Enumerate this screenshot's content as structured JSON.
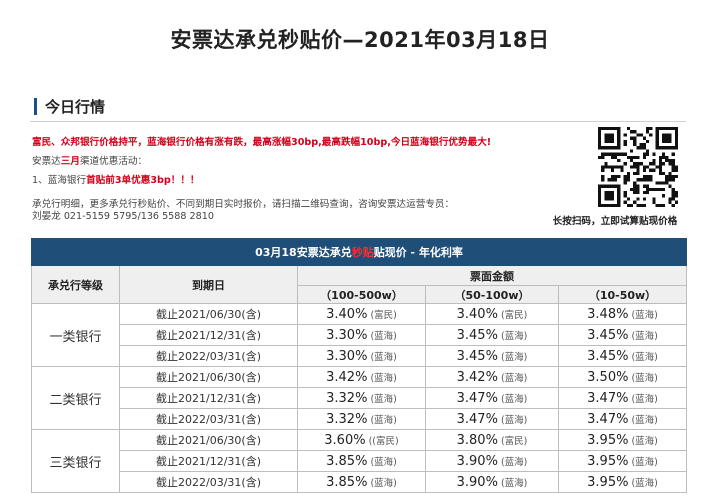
{
  "page_title": "安票达承兑秒贴价—2021年03月18日",
  "section_title": "今日行情",
  "notice": {
    "headline": "富民、众邦银行价格持平，蓝海银行价格有涨有跌，最高涨幅30bp,最高跌幅10bp,今日蓝海银行优势最大!",
    "promo_prefix": "安票达",
    "promo_highlight": "三月",
    "promo_suffix": "渠道优惠活动：",
    "promo_item_prefix": "1、蓝海银行",
    "promo_item_highlight": "首贴前3单优惠3bp！！！",
    "contact_line1": "承兑行明细，更多承兑行秒贴价、不同到期日实时报价，请扫描二维码查询，咨询安票达运营专员：",
    "contact_line2": "刘晏龙 021-5159 5795/136 5588 2810"
  },
  "qr": {
    "icon": "qr-code-icon",
    "caption": "长按扫码，立即试算贴现价格"
  },
  "table": {
    "title_prefix": "03月18安票达承兑",
    "title_highlight": "秒贴",
    "title_suffix": "贴现价 - 年化利率",
    "header_bank": "承兑行等级",
    "header_date": "到期日",
    "header_amount": "票面金额",
    "amount_cols": [
      "（100-500w）",
      "（50-100w）",
      "（10-50w）"
    ],
    "groups": [
      {
        "bank": "一类银行",
        "rows": [
          {
            "date": "截止2021/06/30(含)",
            "cells": [
              {
                "rate": "3.40%",
                "src": " (富民)"
              },
              {
                "rate": "3.40%",
                "src": " (富民)"
              },
              {
                "rate": "3.48%",
                "src": " (蓝海)"
              }
            ]
          },
          {
            "date": "截止2021/12/31(含)",
            "cells": [
              {
                "rate": "3.30%",
                "src": " (蓝海)"
              },
              {
                "rate": "3.45%",
                "src": " (蓝海)"
              },
              {
                "rate": "3.45%",
                "src": " (蓝海)"
              }
            ]
          },
          {
            "date": "截止2022/03/31(含)",
            "cells": [
              {
                "rate": "3.30%",
                "src": " (蓝海)"
              },
              {
                "rate": "3.45%",
                "src": " (蓝海)"
              },
              {
                "rate": "3.45%",
                "src": " (蓝海)"
              }
            ]
          }
        ]
      },
      {
        "bank": "二类银行",
        "rows": [
          {
            "date": "截止2021/06/30(含)",
            "cells": [
              {
                "rate": "3.42%",
                "src": " (蓝海)"
              },
              {
                "rate": "3.42%",
                "src": " (蓝海)"
              },
              {
                "rate": "3.50%",
                "src": " (蓝海)"
              }
            ]
          },
          {
            "date": "截止2021/12/31(含)",
            "cells": [
              {
                "rate": "3.32%",
                "src": " (蓝海)"
              },
              {
                "rate": "3.47%",
                "src": " (蓝海)"
              },
              {
                "rate": "3.47%",
                "src": " (蓝海)"
              }
            ]
          },
          {
            "date": "截止2022/03/31(含)",
            "cells": [
              {
                "rate": "3.32%",
                "src": " (蓝海)"
              },
              {
                "rate": "3.47%",
                "src": " (蓝海)"
              },
              {
                "rate": "3.47%",
                "src": " (蓝海)"
              }
            ]
          }
        ]
      },
      {
        "bank": "三类银行",
        "rows": [
          {
            "date": "截止2021/06/30(含)",
            "cells": [
              {
                "rate": "3.60%",
                "src": " ((富民)"
              },
              {
                "rate": "3.80%",
                "src": " (富民)"
              },
              {
                "rate": "3.95%",
                "src": " (蓝海)"
              }
            ]
          },
          {
            "date": "截止2021/12/31(含)",
            "cells": [
              {
                "rate": "3.85%",
                "src": " (蓝海)"
              },
              {
                "rate": "3.90%",
                "src": " (蓝海)"
              },
              {
                "rate": "3.95%",
                "src": " (蓝海)"
              }
            ]
          },
          {
            "date": "截止2022/03/31(含)",
            "cells": [
              {
                "rate": "3.85%",
                "src": " (蓝海)"
              },
              {
                "rate": "3.90%",
                "src": " (蓝海)"
              },
              {
                "rate": "3.95%",
                "src": " (蓝海)"
              }
            ]
          }
        ]
      }
    ]
  }
}
